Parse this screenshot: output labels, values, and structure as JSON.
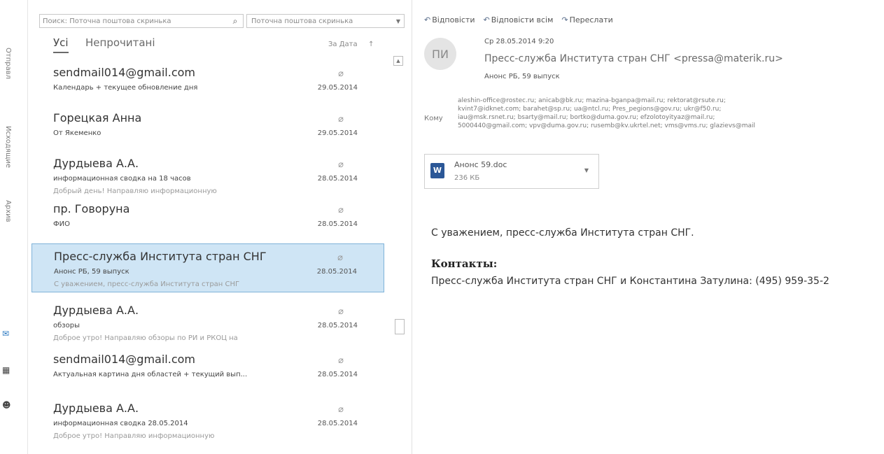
{
  "nav": {
    "vertical_labels": [
      "Отправл",
      "Исходящие",
      "Архив"
    ],
    "icons": [
      "mail-icon",
      "calendar-icon",
      "people-icon"
    ]
  },
  "search": {
    "placeholder": "Поиск: Поточна поштова скринька",
    "scope": "Поточна поштова скринька"
  },
  "tabs": [
    {
      "label": "Усі",
      "active": true
    },
    {
      "label": "Непрочитані",
      "active": false
    }
  ],
  "sort": {
    "label": "За Дата",
    "arrow": "↑"
  },
  "messages": [
    {
      "sender": "sendmail014@gmail.com",
      "subject": "Календарь + текущее обновление дня",
      "preview": "",
      "date": "29.05.2014",
      "selected": false
    },
    {
      "sender": "Горецкая Анна",
      "subject": "От Якеменко",
      "preview": "",
      "date": "29.05.2014",
      "selected": false
    },
    {
      "sender": "Дурдыева А.А.",
      "subject": "информационная сводка на 18 часов",
      "preview": "Добрый день! Направляю информационную",
      "date": "28.05.2014",
      "selected": false
    },
    {
      "sender": "пр. Говоруна",
      "subject": "ФИО",
      "preview": "",
      "date": "28.05.2014",
      "selected": false
    },
    {
      "sender": "Пресс-служба Института стран СНГ",
      "subject": "Анонс РБ, 59 выпуск",
      "preview": "С уважением, пресс-служба Института стран СНГ",
      "date": "28.05.2014",
      "selected": true
    },
    {
      "sender": "Дурдыева А.А.",
      "subject": "обзоры",
      "preview": "Доброе утро! Направляю обзоры по РИ и РКОЦ на",
      "date": "28.05.2014",
      "selected": false
    },
    {
      "sender": "sendmail014@gmail.com",
      "subject": "Актуальная картина дня областей + текущий вып...",
      "preview": "",
      "date": "28.05.2014",
      "selected": false
    },
    {
      "sender": "Дурдыева А.А.",
      "subject": "информационная сводка 28.05.2014",
      "preview": "Доброе утро! Направляю информационную",
      "date": "28.05.2014",
      "selected": false
    }
  ],
  "reading": {
    "actions": [
      {
        "label": "Відповісти",
        "icon": "reply-icon"
      },
      {
        "label": "Відповісти всім",
        "icon": "reply-all-icon"
      },
      {
        "label": "Переслати",
        "icon": "forward-icon"
      }
    ],
    "avatar_initials": "ПИ",
    "sent": "Ср 28.05.2014 9:20",
    "from": "Пресс-служба Института стран СНГ <pressa@materik.ru>",
    "subject": "Анонс РБ, 59 выпуск",
    "to_label": "Кому",
    "recipients": [
      "aleshin-office@rostec.ru; anicab@bk.ru; mazina-bganpa@mail.ru; rektorat@rsute.ru;",
      "kvint7@idknet.com; barahet@sp.ru; ua@ntcl.ru; Pres_pegions@gov.ru; ukr@f50.ru;",
      "iau@msk.rsnet.ru; bsarty@mail.ru; bortko@duma.gov.ru; efzolotoyityaz@mail.ru;",
      "5000440@gmail.com; vpv@duma.gov.ru; rusemb@kv.ukrtel.net; vms@vms.ru; glazievs@mail"
    ],
    "attachment": {
      "name": "Анонс 59.doc",
      "size": "236 КБ",
      "icon": "word-doc-icon"
    },
    "signature": "С уважением, пресс-служба Института стран СНГ.",
    "contacts_label": "Контакты:",
    "contacts_text": "Пресс-служба Института стран СНГ и Константина Затулина: (495) 959-35-2"
  }
}
